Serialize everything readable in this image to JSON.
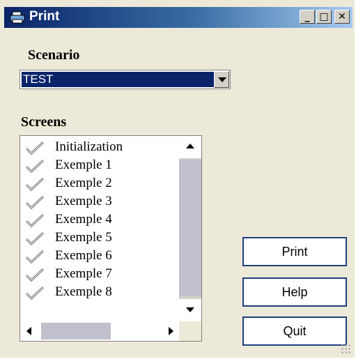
{
  "window": {
    "title": "Print",
    "controls": {
      "minimize": "_",
      "maximize": "□",
      "close": "✕"
    }
  },
  "scenario": {
    "label": "Scenario",
    "selected": "TEST"
  },
  "screens": {
    "label": "Screens",
    "items": [
      {
        "label": "Initialization",
        "checked": true
      },
      {
        "label": "Exemple 1",
        "checked": true
      },
      {
        "label": "Exemple 2",
        "checked": true
      },
      {
        "label": "Exemple 3",
        "checked": true
      },
      {
        "label": "Exemple 4",
        "checked": true
      },
      {
        "label": "Exemple 5",
        "checked": true
      },
      {
        "label": "Exemple 6",
        "checked": true
      },
      {
        "label": "Exemple 7",
        "checked": true
      },
      {
        "label": "Exemple 8",
        "checked": true
      }
    ]
  },
  "buttons": {
    "print": "Print",
    "help": "Help",
    "quit": "Quit"
  },
  "icons": {
    "title": "printer-icon",
    "check": "checkmark-icon"
  },
  "colors": {
    "titlebar_start": "#0a246a",
    "titlebar_end": "#a6caf0",
    "selection": "#0a246a",
    "button_border": "#1f3f7f"
  }
}
